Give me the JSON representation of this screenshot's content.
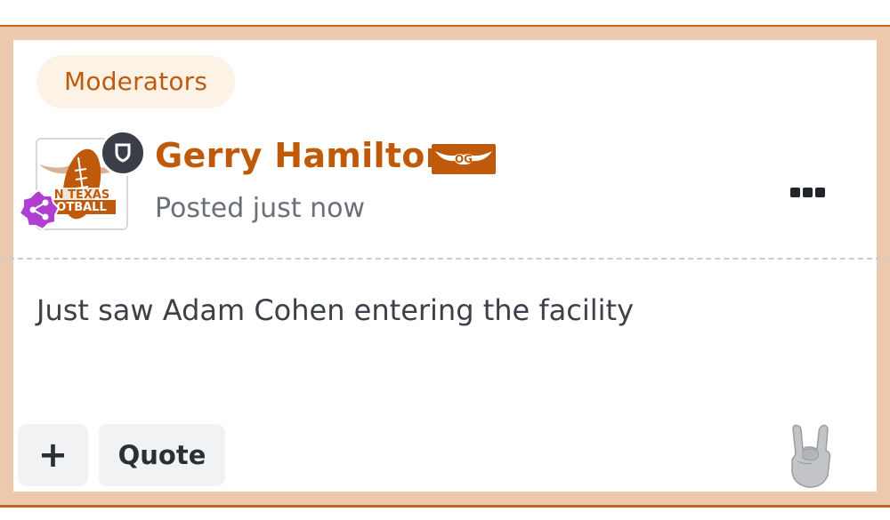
{
  "group_badge": "Moderators",
  "post": {
    "author": "Gerry Hamilton",
    "author_badge": "OG",
    "timestamp": "Posted just now",
    "body": "Just saw Adam Cohen entering the facility",
    "avatar_text_line1": "N TEXAS",
    "avatar_text_line2": "OOTBALL"
  },
  "actions": {
    "plus_label": "+",
    "quote_label": "Quote"
  },
  "icons": {
    "more": "more-icon",
    "shield": "shield-icon",
    "share": "share-icon",
    "reaction": "hook-em-horns-icon"
  },
  "colors": {
    "accent": "#bf5a0b",
    "frame": "#ecc8ad",
    "badge_bg": "#fdf2e6",
    "share_badge": "#b03fd1"
  }
}
